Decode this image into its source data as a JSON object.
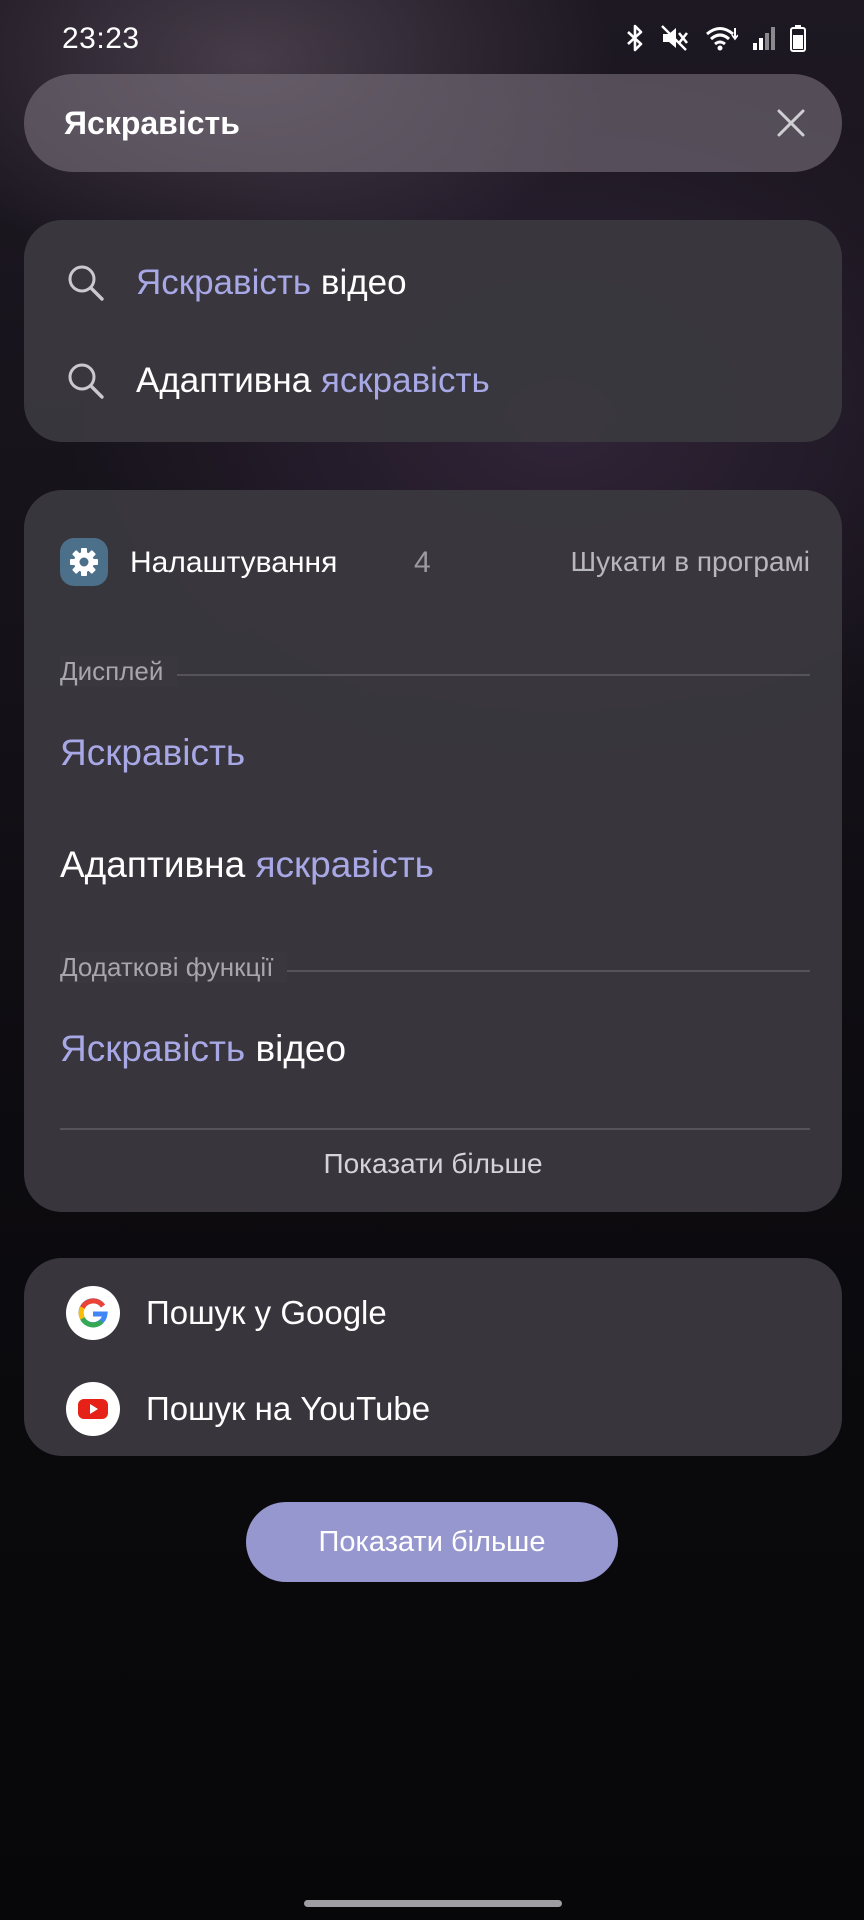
{
  "status_bar": {
    "time": "23:23",
    "icons": [
      "bluetooth-icon",
      "mute-icon",
      "wifi-icon",
      "signal-icon",
      "battery-icon"
    ]
  },
  "search": {
    "query": "Яскравість",
    "clear_icon": "close-icon"
  },
  "suggestions": [
    {
      "icon": "search-icon",
      "highlight": "Яскравість",
      "rest": " відео"
    },
    {
      "icon": "search-icon",
      "prefix": "Адаптивна ",
      "highlight": "яскравість"
    }
  ],
  "settings_app": {
    "name": "Налаштування",
    "count": "4",
    "search_in_app": "Шукати в програмі",
    "icon": "gear-icon",
    "sections": [
      {
        "label": "Дисплей",
        "results": [
          {
            "prefix": "",
            "highlight": "Яскравість",
            "rest": ""
          },
          {
            "prefix": "Адаптивна ",
            "highlight": "яскравість",
            "rest": ""
          }
        ]
      },
      {
        "label": "Додаткові функції",
        "results": [
          {
            "prefix": "",
            "highlight": "Яскравість",
            "rest": " відео"
          }
        ]
      }
    ],
    "show_more": "Показати більше"
  },
  "web_search": [
    {
      "icon": "google-icon",
      "label": "Пошук у Google"
    },
    {
      "icon": "youtube-icon",
      "label": "Пошук на YouTube"
    }
  ],
  "show_more_button": "Показати більше",
  "colors": {
    "highlight": "#a8a8e6",
    "button": "#9797cf",
    "card": "#3a383e"
  }
}
